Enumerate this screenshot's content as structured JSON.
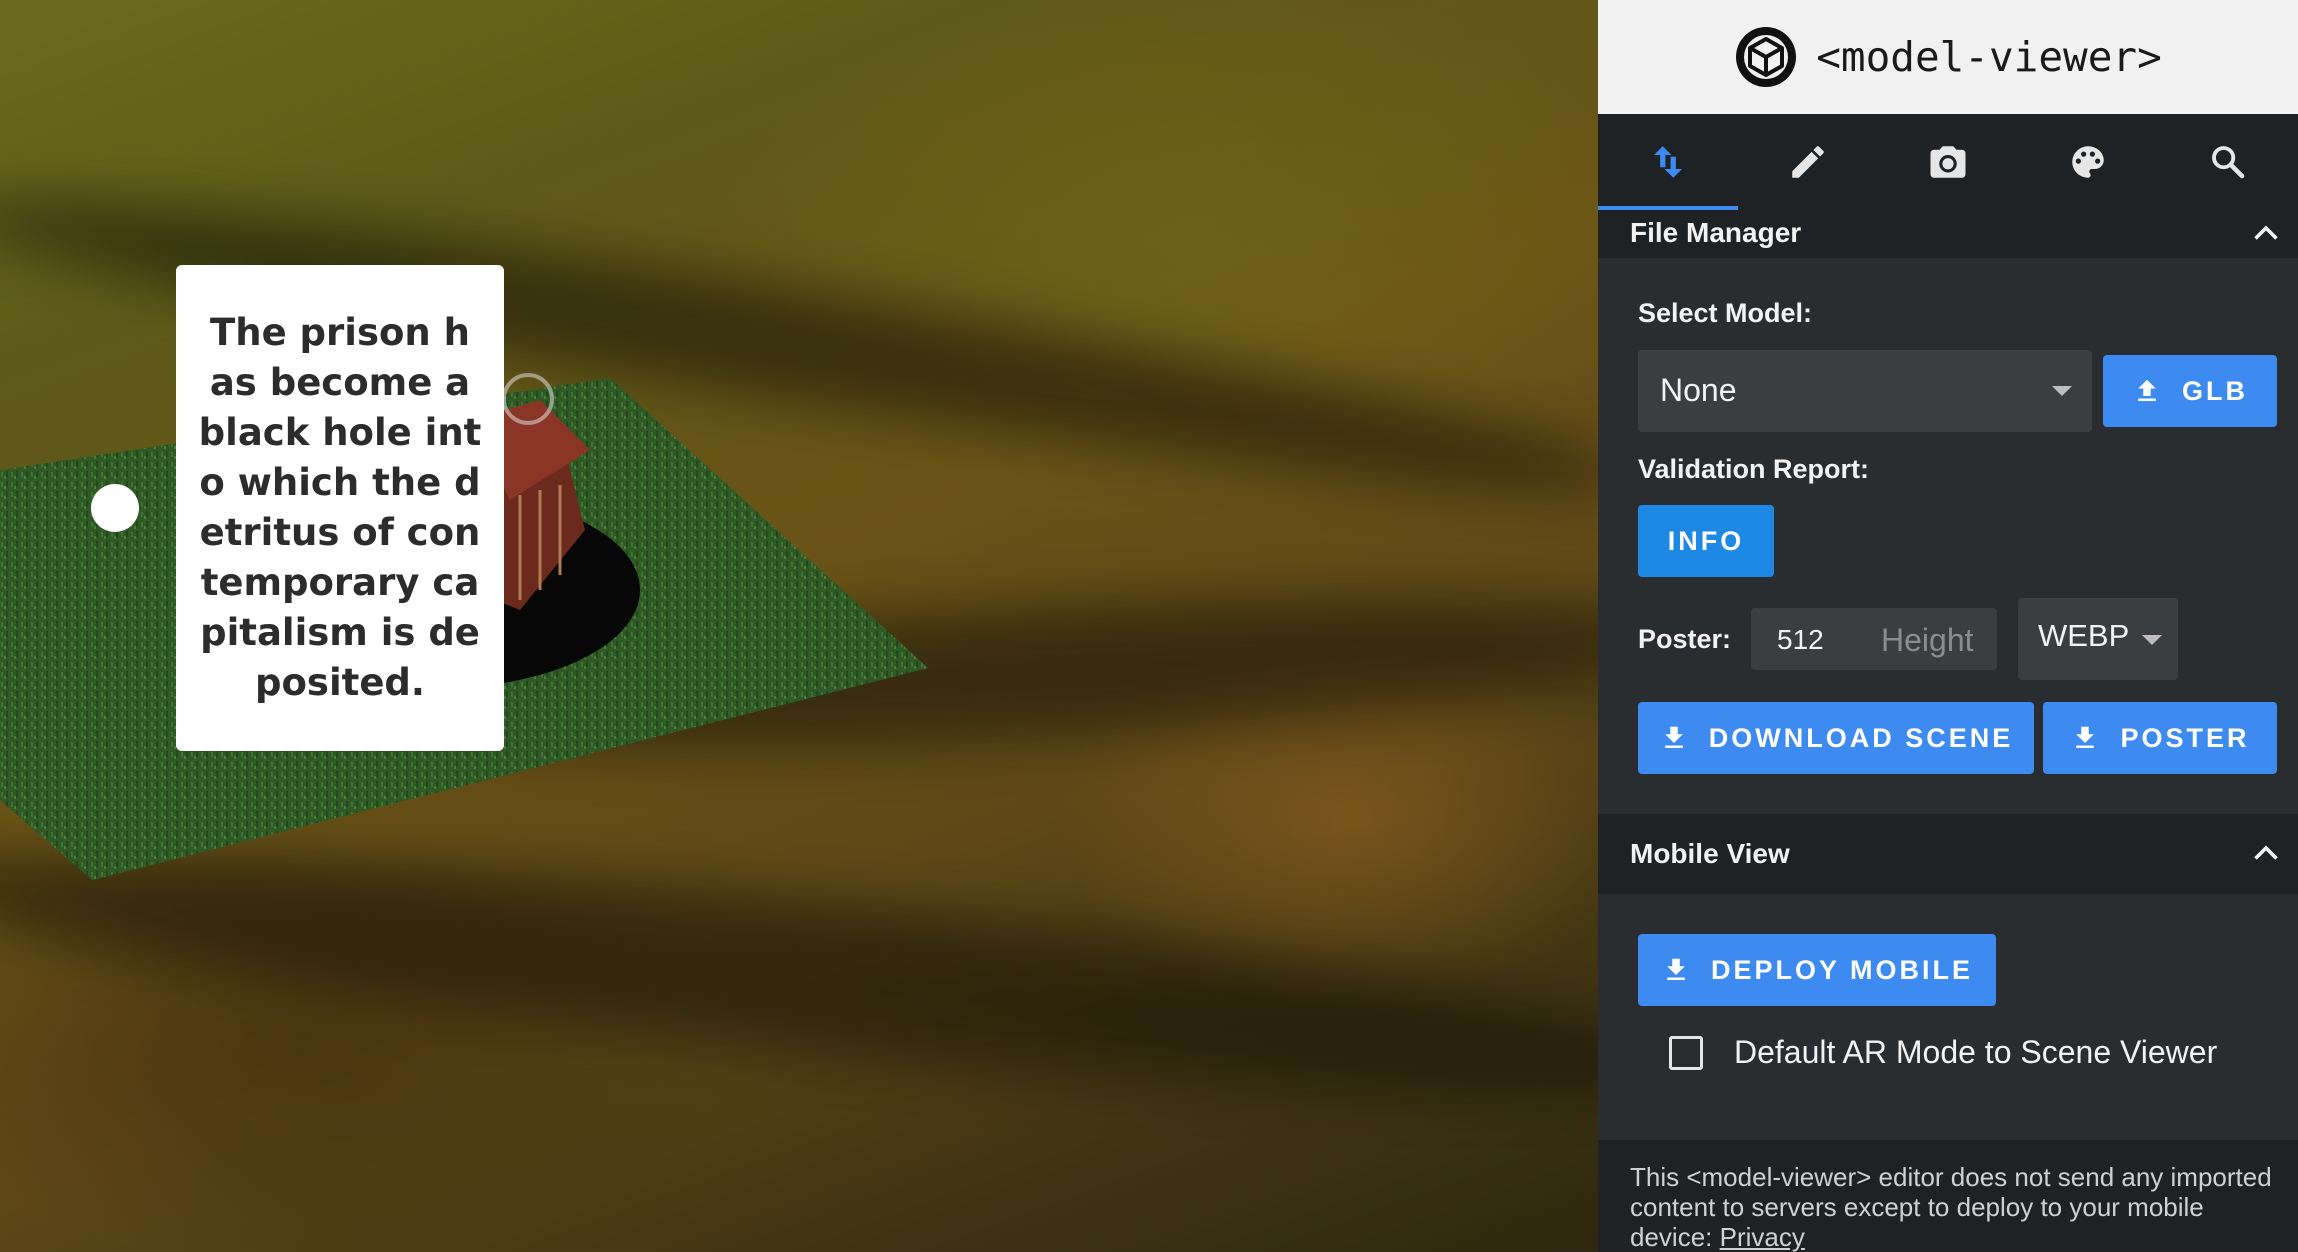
{
  "viewport": {
    "annotation_text": "The prison has become a black hole into which the detritus of contemporary capitalism is deposited."
  },
  "panel": {
    "app_title": "<model-viewer>",
    "tabs": [
      {
        "icon": "swap-vert-icon",
        "active": true
      },
      {
        "icon": "pencil-icon",
        "active": false
      },
      {
        "icon": "camera-icon",
        "active": false
      },
      {
        "icon": "palette-icon",
        "active": false
      },
      {
        "icon": "search-icon",
        "active": false
      }
    ],
    "file_manager": {
      "title": "File Manager",
      "select_model_label": "Select Model:",
      "select_model_value": "None",
      "glb_button": "GLB",
      "validation_label": "Validation Report:",
      "info_button": "INFO",
      "poster_label": "Poster:",
      "poster_width": "512",
      "poster_height_placeholder": "Height",
      "poster_format": "WEBP",
      "download_scene_button": "DOWNLOAD SCENE",
      "poster_button": "POSTER"
    },
    "mobile_view": {
      "title": "Mobile View",
      "deploy_button": "DEPLOY MOBILE",
      "ar_checkbox_label": "Default AR Mode to Scene Viewer",
      "ar_checkbox_checked": false
    },
    "footer": {
      "text": "This <model-viewer> editor does not send any imported content to servers except to deploy to your mobile device:",
      "privacy_link": "Privacy"
    }
  },
  "colors": {
    "accent": "#3d8bf0",
    "info_button": "#1e88e5",
    "panel_bg": "#2a2d30",
    "header_bg": "#f1f1f1"
  }
}
